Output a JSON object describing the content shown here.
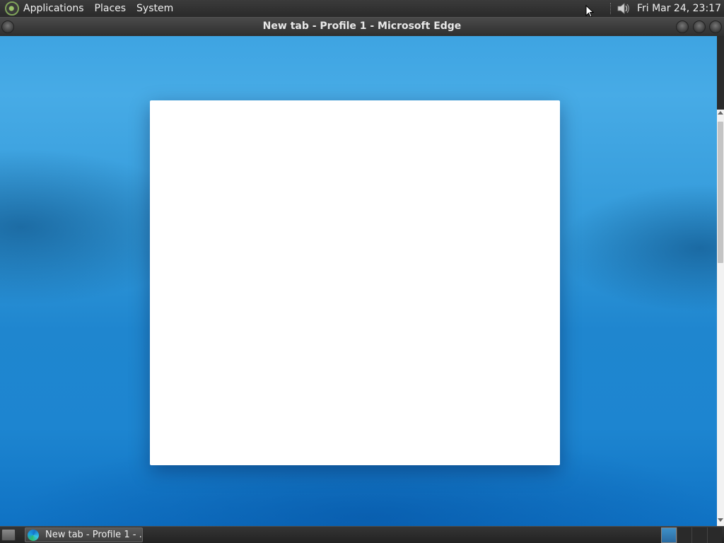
{
  "top_panel": {
    "menus": [
      "Applications",
      "Places",
      "System"
    ],
    "clock": "Fri Mar 24, 23:17"
  },
  "window": {
    "title": "New tab - Profile 1 - Microsoft Edge"
  },
  "taskbar": {
    "task_label": "New tab - Profile 1 - …"
  },
  "icons": {
    "panel_logo": "distro-logo-icon",
    "volume": "speaker-icon",
    "browser": "edge-icon",
    "show_desktop": "show-desktop-icon",
    "cursor": "mouse-pointer-icon"
  },
  "colors": {
    "background_top": "#47abe6",
    "background_bottom": "#0f72c4",
    "panel": "#2e2e2e",
    "card": "#ffffff"
  }
}
